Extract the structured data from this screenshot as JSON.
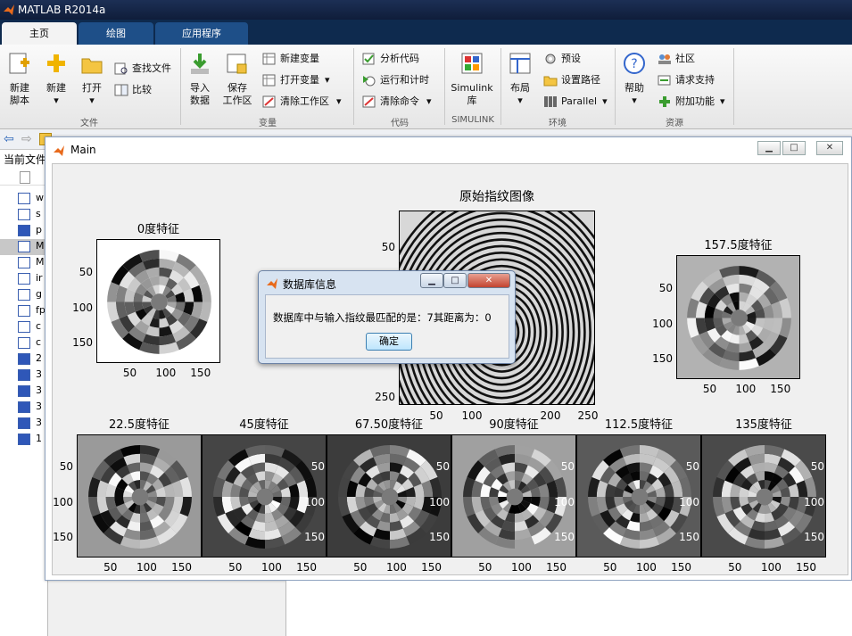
{
  "app": {
    "title": "MATLAB R2014a"
  },
  "tabs": [
    {
      "label": "主页"
    },
    {
      "label": "绘图"
    },
    {
      "label": "应用程序"
    }
  ],
  "ribbon": {
    "new_script": [
      "新建",
      "脚本"
    ],
    "new": "新建",
    "open": "打开",
    "find_files": "查找文件",
    "compare": "比较",
    "import": [
      "导入",
      "数据"
    ],
    "save_ws": [
      "保存",
      "工作区"
    ],
    "new_variable": "新建变量",
    "open_variable": "打开变量",
    "clear_workspace": "清除工作区",
    "analyze_code": "分析代码",
    "run_and_time": "运行和计时",
    "clear_commands": "清除命令",
    "simulink": [
      "Simulink",
      "库"
    ],
    "layout": "布局",
    "preferences": "预设",
    "set_path": "设置路径",
    "parallel": "Parallel",
    "help": "帮助",
    "community": "社区",
    "request_support": "请求支持",
    "addons": "附加功能",
    "groups": {
      "file": "文件",
      "variable": "变量",
      "code": "代码",
      "simulink": "SIMULINK",
      "environment": "环境",
      "resources": "资源"
    }
  },
  "left_panel": {
    "title": "当前文件",
    "files": [
      "w",
      "s",
      "p",
      "M",
      "M",
      "ir",
      "g",
      "fp",
      "c",
      "c",
      "2",
      "3",
      "3",
      "3",
      "3",
      "1"
    ]
  },
  "figure_window": {
    "title": "Main",
    "plots": {
      "original": {
        "title": "原始指纹图像",
        "yticks": [
          "50",
          "250"
        ],
        "xticks": [
          "50",
          "100",
          "200",
          "250"
        ]
      },
      "f0": {
        "title": "0度特征"
      },
      "f1575": {
        "title": "157.5度特征"
      },
      "f225": {
        "title": "22.5度特征"
      },
      "f45": {
        "title": "45度特征"
      },
      "f675": {
        "title": "67.50度特征"
      },
      "f90": {
        "title": "90度特征"
      },
      "f1125": {
        "title": "112.5度特征"
      },
      "f135": {
        "title": "135度特征"
      }
    },
    "ticks": [
      "50",
      "100",
      "150"
    ]
  },
  "dialog": {
    "title": "数据库信息",
    "message": "数据库中与输入指纹最匹配的是：7其距离为：0",
    "ok": "确定"
  },
  "colors": {
    "accent": "#1e4f88",
    "titlebar": "#0f1d3a"
  }
}
